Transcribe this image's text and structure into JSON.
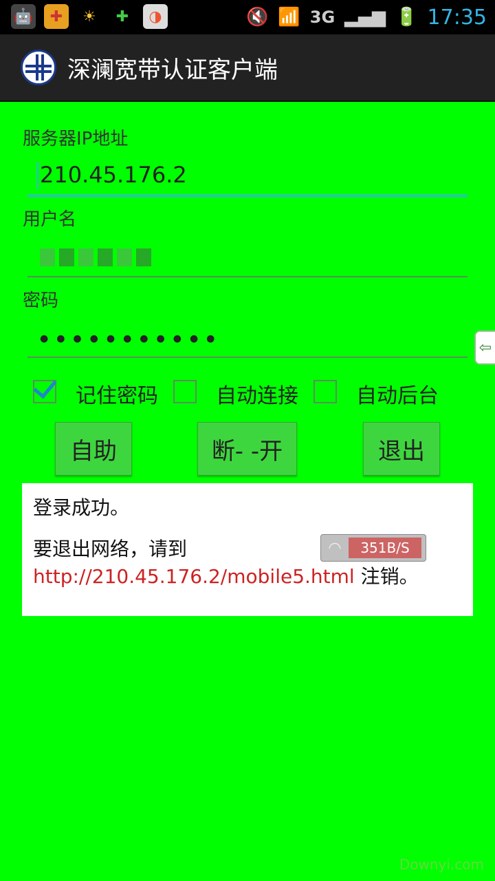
{
  "status": {
    "time": "17:35",
    "network": "3G",
    "icons": [
      "android-icon",
      "app-icon",
      "weather-icon",
      "plus-icon",
      "store-icon"
    ]
  },
  "app": {
    "title": "深澜宽带认证客户端"
  },
  "form": {
    "server_label": "服务器IP地址",
    "server_value": "210.45.176.2",
    "username_label": "用户名",
    "password_label": "密码",
    "password_mask": "●●●●●●●●●●●"
  },
  "options": {
    "remember": {
      "label": "记住密码",
      "checked": true
    },
    "auto_connect": {
      "label": "自动连接",
      "checked": false
    },
    "auto_background": {
      "label": "自动后台",
      "checked": false
    }
  },
  "buttons": {
    "help": "自助",
    "toggle": "断- -开",
    "exit": "退出"
  },
  "message": {
    "line1": "登录成功。",
    "line2_prefix": "要退出网络，请到 ",
    "link": "http://210.45.176.2/mobile5.html",
    "line2_suffix": " 注销。"
  },
  "speed_widget": {
    "rate": "351B/S"
  },
  "watermark": "Downyi.com",
  "colors": {
    "background": "#00ff00",
    "accent": "#33b5e5",
    "link": "#cc2222"
  }
}
